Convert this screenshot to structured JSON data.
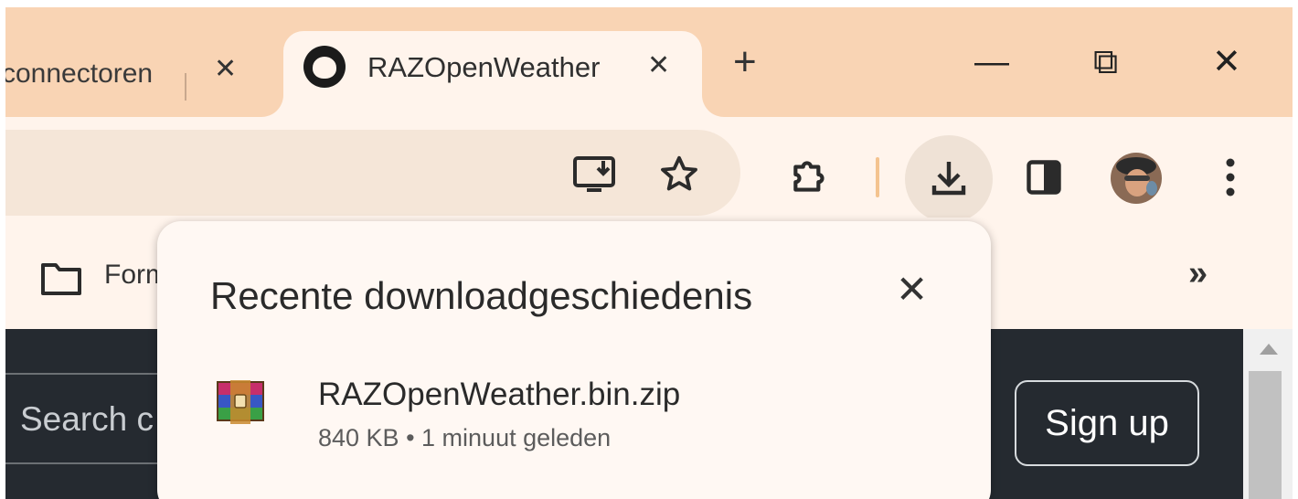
{
  "tabs": {
    "inactive_title": "connectoren",
    "active_title": "RAZOpenWeather",
    "close_glyph": "✕",
    "new_tab_glyph": "+",
    "github_icon": "github-icon"
  },
  "window_controls": {
    "minimize": "—",
    "restore": "⧉",
    "close": "✕"
  },
  "toolbar": {
    "icons": [
      "install-app-icon",
      "bookmark-star-icon",
      "extensions-icon",
      "download-icon",
      "side-panel-icon",
      "profile-avatar",
      "more-menu-icon"
    ],
    "accent": "#f4c38f"
  },
  "bookmarks_bar": {
    "folder_label": "Form",
    "more_glyph": "»"
  },
  "page": {
    "search_placeholder": "Search c",
    "signup_label": "Sign up",
    "background": "#252a30"
  },
  "download_popup": {
    "title": "Recente downloadgeschiedenis",
    "close_glyph": "✕",
    "items": [
      {
        "file_name": "RAZOpenWeather.bin.zip",
        "meta": "840  KB • 1 minuut geleden",
        "icon": "winrar-archive-icon"
      }
    ]
  }
}
